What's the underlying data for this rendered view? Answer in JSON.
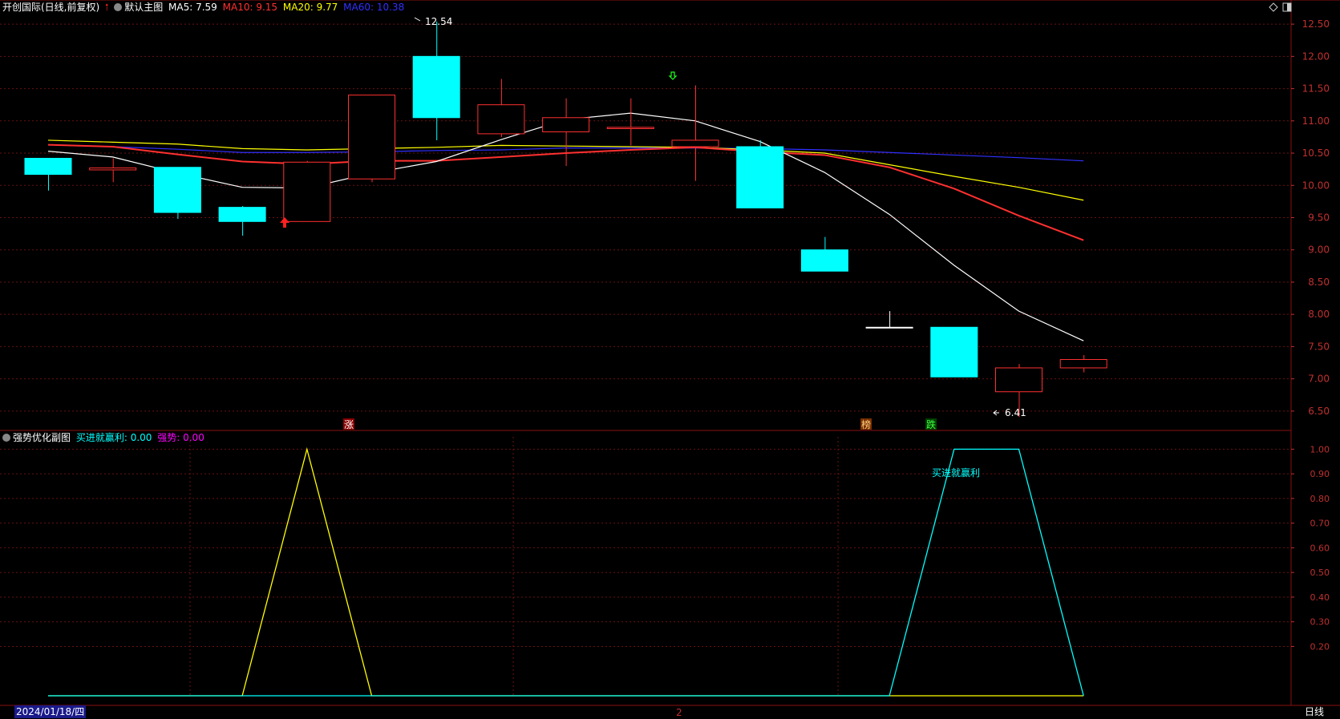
{
  "header": {
    "stock": "开创国际(日线,前复权)",
    "main_chart": "默认主图",
    "ma5": {
      "label": "MA5: 7.59",
      "color": "#ffffff"
    },
    "ma10": {
      "label": "MA10: 9.15",
      "color": "#ff3030"
    },
    "ma20": {
      "label": "MA20: 9.77",
      "color": "#ffff00"
    },
    "ma60": {
      "label": "MA60: 10.38",
      "color": "#3030ff"
    }
  },
  "sub_header": {
    "title": "强势优化副图",
    "series1": {
      "label": "买进就赢利: 0.00",
      "color": "#00ffff"
    },
    "series2": {
      "label": "强势: 0.00",
      "color": "#ff00ff"
    }
  },
  "footer": {
    "date": "2024/01/18/四",
    "period": "日线",
    "marker": "2"
  },
  "colors": {
    "up": "#ff3030",
    "down": "#00ffff",
    "grid": "#6a1010",
    "axis": "#c03030"
  },
  "chart_data": [
    {
      "type": "candlestick",
      "ylim": [
        6.2,
        12.75
      ],
      "yticks": [
        "12.50",
        "12.00",
        "11.50",
        "11.00",
        "10.50",
        "10.00",
        "9.50",
        "9.00",
        "8.50",
        "8.00",
        "7.50",
        "7.00",
        "6.50"
      ],
      "candles": [
        {
          "o": 10.42,
          "c": 10.17,
          "h": 10.42,
          "l": 9.92
        },
        {
          "o": 10.24,
          "c": 10.27,
          "h": 10.42,
          "l": 10.05
        },
        {
          "o": 10.28,
          "c": 9.58,
          "h": 10.28,
          "l": 9.48
        },
        {
          "o": 9.66,
          "c": 9.44,
          "h": 9.68,
          "l": 9.22
        },
        {
          "o": 9.44,
          "c": 10.36,
          "h": 10.38,
          "l": 9.44
        },
        {
          "o": 10.1,
          "c": 11.4,
          "h": 11.4,
          "l": 10.05
        },
        {
          "o": 12.0,
          "c": 11.05,
          "h": 12.54,
          "l": 10.7
        },
        {
          "o": 10.8,
          "c": 11.25,
          "h": 11.65,
          "l": 10.75
        },
        {
          "o": 10.83,
          "c": 11.05,
          "h": 11.35,
          "l": 10.3
        },
        {
          "o": 10.88,
          "c": 10.9,
          "h": 11.35,
          "l": 10.62
        },
        {
          "o": 10.6,
          "c": 10.7,
          "h": 11.55,
          "l": 10.07
        },
        {
          "o": 10.6,
          "c": 9.65,
          "h": 10.7,
          "l": 9.65
        },
        {
          "o": 9.0,
          "c": 8.67,
          "h": 9.2,
          "l": 8.67
        },
        {
          "o": 7.8,
          "c": 7.8,
          "h": 8.05,
          "l": 7.8
        },
        {
          "o": 7.8,
          "c": 7.03,
          "h": 7.8,
          "l": 7.03
        },
        {
          "o": 6.8,
          "c": 7.17,
          "h": 7.23,
          "l": 6.41
        },
        {
          "o": 7.17,
          "c": 7.3,
          "h": 7.37,
          "l": 7.1
        }
      ],
      "ma5": [
        10.53,
        10.44,
        10.19,
        9.97,
        9.96,
        10.19,
        10.37,
        10.71,
        11.02,
        11.12,
        11.0,
        10.68,
        10.2,
        9.55,
        8.76,
        8.05,
        7.59
      ],
      "ma10": [
        10.63,
        10.6,
        10.48,
        10.37,
        10.33,
        10.38,
        10.38,
        10.44,
        10.5,
        10.55,
        10.59,
        10.52,
        10.47,
        10.28,
        9.95,
        9.53,
        9.15
      ],
      "ma20": [
        10.7,
        10.67,
        10.64,
        10.57,
        10.55,
        10.57,
        10.59,
        10.62,
        10.61,
        10.6,
        10.59,
        10.55,
        10.5,
        10.32,
        10.14,
        9.97,
        9.77
      ],
      "ma60": [
        10.63,
        10.6,
        10.56,
        10.51,
        10.51,
        10.52,
        10.54,
        10.55,
        10.58,
        10.58,
        10.58,
        10.57,
        10.55,
        10.51,
        10.47,
        10.43,
        10.38
      ],
      "annotations": {
        "high": "12.54",
        "low": "6.41"
      },
      "markers": [
        "涨",
        "榜",
        "跌"
      ]
    },
    {
      "type": "line",
      "ylim": [
        0,
        1.05
      ],
      "yticks": [
        "1.00",
        "0.90",
        "0.80",
        "0.70",
        "0.60",
        "0.50",
        "0.40",
        "0.30",
        "0.20"
      ],
      "series": [
        {
          "name": "强势",
          "color": "#ffff00",
          "values": [
            0,
            0,
            0,
            0,
            1,
            0,
            0,
            0,
            0,
            0,
            0,
            0,
            0,
            0,
            0,
            0,
            0
          ]
        },
        {
          "name": "买进就赢利",
          "color": "#00ffff",
          "values": [
            0,
            0,
            0,
            0,
            0,
            0,
            0,
            0,
            0,
            0,
            0,
            0,
            0,
            0,
            1,
            1,
            0
          ]
        }
      ],
      "annotation": "买进就赢利"
    }
  ]
}
